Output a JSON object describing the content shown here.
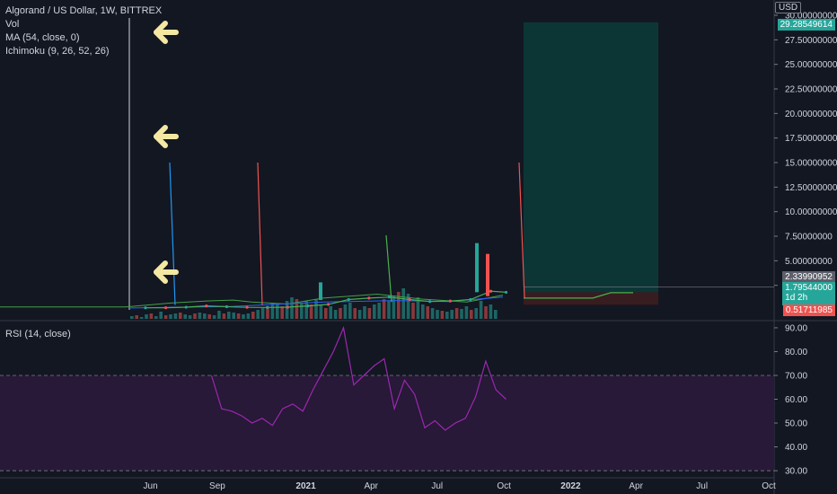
{
  "legend": {
    "title": "Algorand / US Dollar, 1W, BITTREX",
    "volume": "Vol",
    "ma": "MA (54, close, 0)",
    "ichimoku": "Ichimoku (9, 26, 52, 26)"
  },
  "rsi_legend": "RSI (14, close)",
  "currency": "USD",
  "price_tags": {
    "current": "29.28549614",
    "target": "2.33990952",
    "last_price": "1.79544000",
    "countdown": "1d 2h",
    "stop": "0.51711985"
  },
  "colors": {
    "background": "#131722",
    "up": "#26a69a",
    "down": "#ef5350",
    "ma": "#4caf50",
    "rsi": "#9c27b0",
    "rsi_band": "#2a1a3a",
    "arrow": "#f5e8a3",
    "position_profit": "#0c3a38",
    "position_loss": "#3d1e20"
  },
  "chart_data": [
    {
      "type": "line",
      "title": "Algorand / US Dollar, 1W, BITTREX",
      "xlabel": "",
      "ylabel": "",
      "x_ticks": [
        "Jun",
        "Sep",
        "2021",
        "Apr",
        "Jul",
        "Oct",
        "2022",
        "Apr",
        "Jul",
        "Oct"
      ],
      "y_ticks": [
        "30.00000000",
        "27.50000000",
        "25.00000000",
        "22.50000000",
        "20.00000000",
        "17.50000000",
        "15.00000000",
        "12.50000000",
        "10.00000000",
        "7.50000000",
        "5.00000000",
        "2.50000000"
      ],
      "ylim": [
        0,
        30
      ],
      "x": [
        "2020-05-25",
        "2020-06-22",
        "2020-07-20",
        "2020-08-17",
        "2020-09-14",
        "2020-10-12",
        "2020-11-09",
        "2020-12-07",
        "2021-01-04",
        "2021-02-01",
        "2021-03-01",
        "2021-03-29",
        "2021-04-26",
        "2021-05-24",
        "2021-06-21",
        "2021-07-19",
        "2021-08-16",
        "2021-09-13",
        "2021-10-04"
      ],
      "series": [
        {
          "values": [
            0.21,
            0.22,
            0.27,
            0.4,
            0.32,
            0.26,
            0.25,
            0.27,
            0.4,
            0.56,
            1.05,
            1.2,
            1.3,
            1.05,
            0.85,
            0.9,
            1.05,
            1.9,
            1.79
          ]
        }
      ],
      "annotations": {
        "position_long": {
          "entry": 1.79544,
          "target": 29.28549614,
          "stop": 0.51711985,
          "marker": 2.33990952
        },
        "vertical_spikes_peak": 15.0,
        "green_spike_peak": 7.6,
        "arrows": 3
      }
    },
    {
      "type": "line",
      "title": "RSI (14, close)",
      "xlabel": "",
      "ylabel": "",
      "y_ticks": [
        "90.00",
        "80.00",
        "70.00",
        "60.00",
        "50.00",
        "40.00",
        "30.00"
      ],
      "ylim": [
        27,
        93
      ],
      "band": [
        30,
        70
      ],
      "x": [
        "2020-08-24",
        "2020-09-07",
        "2020-09-21",
        "2020-10-05",
        "2020-10-19",
        "2020-11-02",
        "2020-11-16",
        "2020-11-30",
        "2020-12-14",
        "2020-12-28",
        "2021-01-11",
        "2021-01-25",
        "2021-02-08",
        "2021-02-22",
        "2021-03-08",
        "2021-03-22",
        "2021-04-05",
        "2021-04-19",
        "2021-05-03",
        "2021-05-17",
        "2021-05-31",
        "2021-06-14",
        "2021-06-28",
        "2021-07-12",
        "2021-07-26",
        "2021-08-09",
        "2021-08-23",
        "2021-09-06",
        "2021-09-20",
        "2021-10-04"
      ],
      "series": [
        {
          "name": "RSI (14, close)",
          "values": [
            70,
            56,
            55,
            53,
            50,
            52,
            49,
            56,
            58,
            55,
            64,
            72,
            80,
            90,
            66,
            70,
            74,
            77,
            56,
            68,
            62,
            48,
            51,
            47,
            50,
            52,
            61,
            76,
            64,
            60
          ]
        }
      ]
    }
  ]
}
